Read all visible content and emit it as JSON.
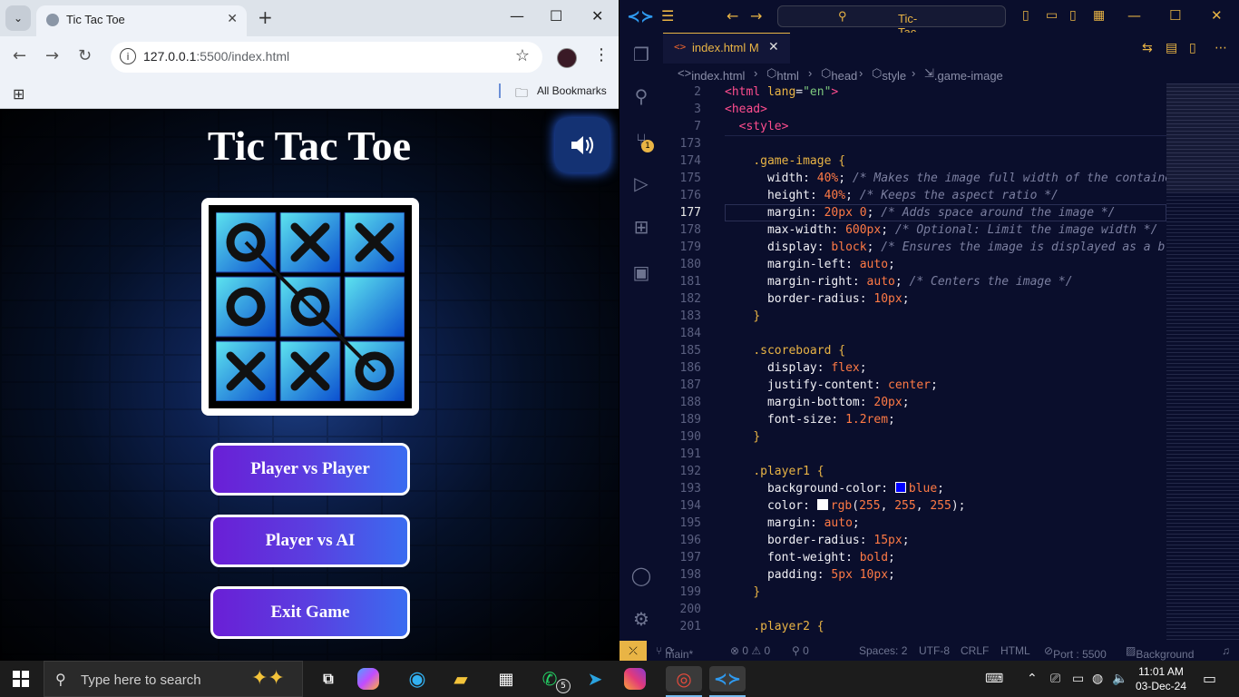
{
  "browser": {
    "tab_title": "Tic Tac Toe",
    "tab_close": "✕",
    "new_tab": "+",
    "url_host": "127.0.0.1",
    "url_rest": ":5500/index.html",
    "bookmarks_label": "All Bookmarks",
    "window_controls": {
      "minimize": "—",
      "maximize": "☐",
      "close": "✕"
    }
  },
  "game": {
    "title": "Tic Tac Toe",
    "board": [
      "O",
      "X",
      "X",
      "O",
      "O",
      "",
      "X",
      "X",
      "O"
    ],
    "winning_line": [
      0,
      4,
      8
    ],
    "buttons": [
      "Player vs Player",
      "Player vs AI",
      "Exit Game"
    ],
    "colors": {
      "button_start": "#6a1fd6",
      "button_end": "#3a6cf0",
      "tile_light": "#5de4ef",
      "tile_dark": "#0b4fd0"
    }
  },
  "vscode": {
    "search_text": "Tic-Tac-Toe-Game!",
    "tab_name": "index.html",
    "tab_modified": "M",
    "breadcrumb": [
      "index.html",
      "html",
      "head",
      "style",
      ".game-image"
    ],
    "scm_badge": "1",
    "current_line": "177",
    "sticky": [
      {
        "ln": "2",
        "html": "<span class='t-tag'>&lt;html</span> <span class='t-attr'>lang</span>=<span class='t-str'>\"en\"</span><span class='t-tag'>&gt;</span>"
      },
      {
        "ln": "3",
        "html": "<span class='t-tag'>&lt;head&gt;</span>"
      },
      {
        "ln": "7",
        "html": "  <span class='t-tag'>&lt;style&gt;</span>"
      }
    ],
    "lines": [
      {
        "ln": "173",
        "html": ""
      },
      {
        "ln": "174",
        "html": "    <span class='t-sel'>.game-image</span> <span class='t-br'>{</span>"
      },
      {
        "ln": "175",
        "html": "      <span class='t-prop'>width</span>: <span class='t-num'>40%</span>; <span class='t-com'>/* Makes the image full width of the containe</span>"
      },
      {
        "ln": "176",
        "html": "      <span class='t-prop'>height</span>: <span class='t-num'>40%</span>; <span class='t-com'>/* Keeps the aspect ratio */</span>"
      },
      {
        "ln": "177",
        "html": "      <span class='t-prop'>margin</span>: <span class='t-num'>20px</span> <span class='t-num'>0</span>; <span class='t-com'>/* Adds space around the image */</span>"
      },
      {
        "ln": "178",
        "html": "      <span class='t-prop'>max-width</span>: <span class='t-num'>600px</span>; <span class='t-com'>/* Optional: Limit the image width */</span>"
      },
      {
        "ln": "179",
        "html": "      <span class='t-prop'>display</span>: <span class='t-val'>block</span>; <span class='t-com'>/* Ensures the image is displayed as a bl</span>"
      },
      {
        "ln": "180",
        "html": "      <span class='t-prop'>margin-left</span>: <span class='t-val'>auto</span>;"
      },
      {
        "ln": "181",
        "html": "      <span class='t-prop'>margin-right</span>: <span class='t-val'>auto</span>; <span class='t-com'>/* Centers the image */</span>"
      },
      {
        "ln": "182",
        "html": "      <span class='t-prop'>border-radius</span>: <span class='t-num'>10px</span>;"
      },
      {
        "ln": "183",
        "html": "    <span class='t-br'>}</span>"
      },
      {
        "ln": "184",
        "html": ""
      },
      {
        "ln": "185",
        "html": "    <span class='t-sel'>.scoreboard</span> <span class='t-br'>{</span>"
      },
      {
        "ln": "186",
        "html": "      <span class='t-prop'>display</span>: <span class='t-val'>flex</span>;"
      },
      {
        "ln": "187",
        "html": "      <span class='t-prop'>justify-content</span>: <span class='t-val'>center</span>;"
      },
      {
        "ln": "188",
        "html": "      <span class='t-prop'>margin-bottom</span>: <span class='t-num'>20px</span>;"
      },
      {
        "ln": "189",
        "html": "      <span class='t-prop'>font-size</span>: <span class='t-num'>1.2rem</span>;"
      },
      {
        "ln": "190",
        "html": "    <span class='t-br'>}</span>"
      },
      {
        "ln": "191",
        "html": ""
      },
      {
        "ln": "192",
        "html": "    <span class='t-sel'>.player1</span> <span class='t-br'>{</span>"
      },
      {
        "ln": "193",
        "html": "      <span class='t-prop'>background-color</span>: <span class='swatch' style='background:#0000ff'></span><span class='t-val'>blue</span>;"
      },
      {
        "ln": "194",
        "html": "      <span class='t-prop'>color</span>: <span class='swatch' style='background:#ffffff'></span><span class='t-val'>rgb</span>(<span class='t-num'>255</span>, <span class='t-num'>255</span>, <span class='t-num'>255</span>);"
      },
      {
        "ln": "195",
        "html": "      <span class='t-prop'>margin</span>: <span class='t-val'>auto</span>;"
      },
      {
        "ln": "196",
        "html": "      <span class='t-prop'>border-radius</span>: <span class='t-num'>15px</span>;"
      },
      {
        "ln": "197",
        "html": "      <span class='t-prop'>font-weight</span>: <span class='t-val'>bold</span>;"
      },
      {
        "ln": "198",
        "html": "      <span class='t-prop'>padding</span>: <span class='t-num'>5px</span> <span class='t-num'>10px</span>;"
      },
      {
        "ln": "199",
        "html": "    <span class='t-br'>}</span>"
      },
      {
        "ln": "200",
        "html": ""
      },
      {
        "ln": "201",
        "html": "    <span class='t-sel'>.player2</span> <span class='t-br'>{</span>"
      }
    ],
    "status": {
      "branch": "main*",
      "problems": "⊗ 0 ⚠ 0",
      "ports": "⚲ 0",
      "spaces": "Spaces: 2",
      "encoding": "UTF-8",
      "eol": "CRLF",
      "language": "HTML",
      "port": "Port : 5500",
      "background": "Background"
    }
  },
  "taskbar": {
    "search_placeholder": "Type here to search",
    "whatsapp_badge": "5",
    "time": "11:01 AM",
    "date": "03-Dec-24"
  }
}
